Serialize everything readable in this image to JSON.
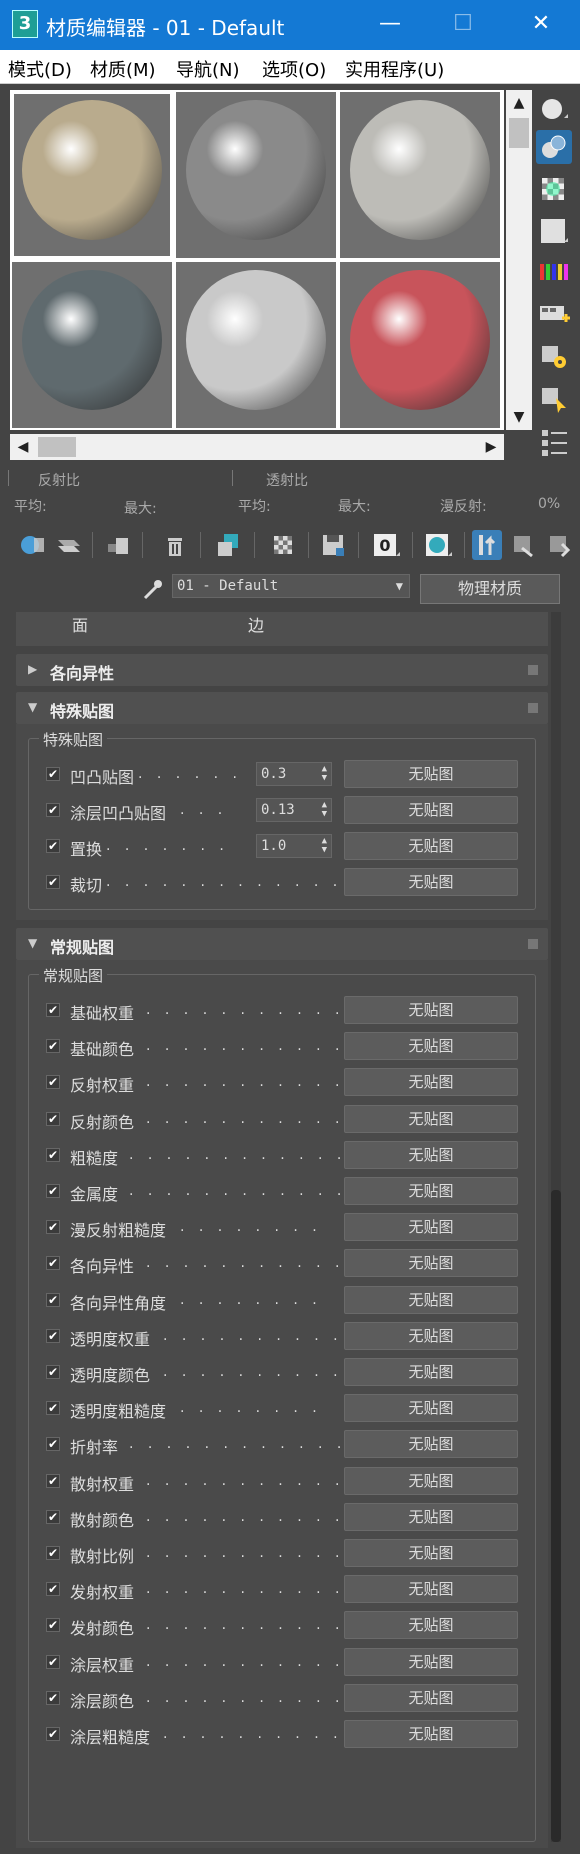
{
  "window": {
    "app_icon": "3",
    "title": "材质编辑器 - 01 - Default",
    "minimize": "—",
    "maximize": "☐",
    "close": "✕"
  },
  "menu": [
    "模式(D)",
    "材质(M)",
    "导航(N)",
    "选项(O)",
    "实用程序(U)"
  ],
  "slots": [
    {
      "color": "#b9ab8d",
      "active": true
    },
    {
      "color": "#8a8a8a",
      "active": false
    },
    {
      "color": "#bdbcb7",
      "active": false
    },
    {
      "color": "#5f6a6e",
      "active": false
    },
    {
      "color": "#c9c9c9",
      "active": false
    },
    {
      "color": "#c8545b",
      "active": false
    }
  ],
  "stats": {
    "reflect_label": "反射比",
    "transmit_label": "透射比",
    "avg1": "平均:",
    "max1": "最大:",
    "avg2": "平均:",
    "max2": "最大:",
    "diffuse": "漫反射:",
    "diffuse_value": "0%"
  },
  "material": {
    "name": "01 - Default",
    "type": "物理材质"
  },
  "partial_rollout": {
    "left": "面",
    "right": "边"
  },
  "rollouts": {
    "anisotropy": "各向异性",
    "special_maps": {
      "title": "特殊贴图",
      "group": "特殊贴图",
      "rows": [
        {
          "label": "凹凸贴图",
          "dots": ". . . . . .",
          "value": "0.3",
          "map": "无贴图"
        },
        {
          "label": "涂层凹凸贴图",
          "dots": ". . .",
          "value": "0.13",
          "map": "无贴图"
        },
        {
          "label": "置换",
          "dots": ". . . . . . .",
          "value": "1.0",
          "map": "无贴图"
        },
        {
          "label": "裁切",
          "dots": ". . . . . . . . . . . . .",
          "map": "无贴图"
        }
      ]
    },
    "general_maps": {
      "title": "常规贴图",
      "group": "常规贴图",
      "rows": [
        {
          "label": "基础权重",
          "dots": ". . . . . . . . . . .",
          "map": "无贴图"
        },
        {
          "label": "基础颜色",
          "dots": ". . . . . . . . . . .",
          "map": "无贴图"
        },
        {
          "label": "反射权重",
          "dots": ". . . . . . . . . . .",
          "map": "无贴图"
        },
        {
          "label": "反射颜色",
          "dots": ". . . . . . . . . . .",
          "map": "无贴图"
        },
        {
          "label": "粗糙度",
          "dots": ". . . . . . . . . . . .",
          "map": "无贴图"
        },
        {
          "label": "金属度",
          "dots": ". . . . . . . . . . . .",
          "map": "无贴图"
        },
        {
          "label": "漫反射粗糙度",
          "dots": ". . . . . . . .",
          "map": "无贴图"
        },
        {
          "label": "各向异性",
          "dots": ". . . . . . . . . . .",
          "map": "无贴图"
        },
        {
          "label": "各向异性角度",
          "dots": ". . . . . . . .",
          "map": "无贴图"
        },
        {
          "label": "透明度权重",
          "dots": ". . . . . . . . . .",
          "map": "无贴图"
        },
        {
          "label": "透明度颜色",
          "dots": ". . . . . . . . . .",
          "map": "无贴图"
        },
        {
          "label": "透明度粗糙度",
          "dots": ". . . . . . . .",
          "map": "无贴图"
        },
        {
          "label": "折射率",
          "dots": ". . . . . . . . . . . .",
          "map": "无贴图"
        },
        {
          "label": "散射权重",
          "dots": ". . . . . . . . . . .",
          "map": "无贴图"
        },
        {
          "label": "散射颜色",
          "dots": ". . . . . . . . . . .",
          "map": "无贴图"
        },
        {
          "label": "散射比例",
          "dots": ". . . . . . . . . . .",
          "map": "无贴图"
        },
        {
          "label": "发射权重",
          "dots": ". . . . . . . . . . .",
          "map": "无贴图"
        },
        {
          "label": "发射颜色",
          "dots": ". . . . . . . . . . .",
          "map": "无贴图"
        },
        {
          "label": "涂层权重",
          "dots": ". . . . . . . . . . .",
          "map": "无贴图"
        },
        {
          "label": "涂层颜色",
          "dots": ". . . . . . . . . . .",
          "map": "无贴图"
        },
        {
          "label": "涂层粗糙度",
          "dots": ". . . . . . . . . .",
          "map": "无贴图"
        }
      ]
    }
  },
  "checkmark": "✔",
  "icons": {
    "toolbar": [
      "get-material-icon",
      "put-to-scene-icon",
      "assign-to-selection-icon",
      "delete-icon",
      "make-unique-icon",
      "put-to-library-icon",
      "save-icon",
      "material-id-icon",
      "show-map-icon",
      "show-end-result-icon",
      "go-to-parent-icon",
      "go-forward-icon"
    ],
    "side": [
      "sample-type-icon",
      "backlight-icon",
      "background-icon",
      "uv-tiling-icon",
      "video-color-check-icon",
      "make-preview-icon",
      "options-icon",
      "select-by-material-icon",
      "material-navigator-icon"
    ]
  },
  "colors": {
    "titlebar": "#1479d4",
    "panel_bg": "#444444",
    "accent": "#3a7fb8"
  }
}
